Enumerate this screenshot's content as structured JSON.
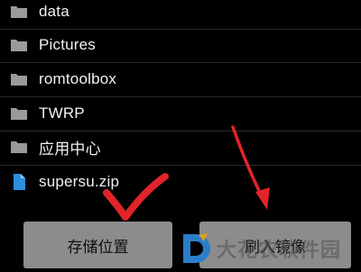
{
  "files": [
    {
      "name": "data",
      "type": "folder"
    },
    {
      "name": "Pictures",
      "type": "folder"
    },
    {
      "name": "romtoolbox",
      "type": "folder"
    },
    {
      "name": "TWRP",
      "type": "folder"
    },
    {
      "name": "应用中心",
      "type": "folder"
    },
    {
      "name": "supersu.zip",
      "type": "zip-file"
    }
  ],
  "buttons": {
    "storage_label": "存储位置",
    "flash_label": "刷入镜像"
  },
  "watermark": {
    "text": "大花农软件园"
  },
  "icons": {
    "folder": "folder-icon",
    "file": "file-icon",
    "checkmark": "checkmark-annotation",
    "arrow": "arrow-annotation"
  },
  "colors": {
    "background": "#000000",
    "folder": "#9a9a9a",
    "zip_file": "#2d8fdc",
    "button": "#8c8c8c",
    "annotation": "#e0242a"
  }
}
